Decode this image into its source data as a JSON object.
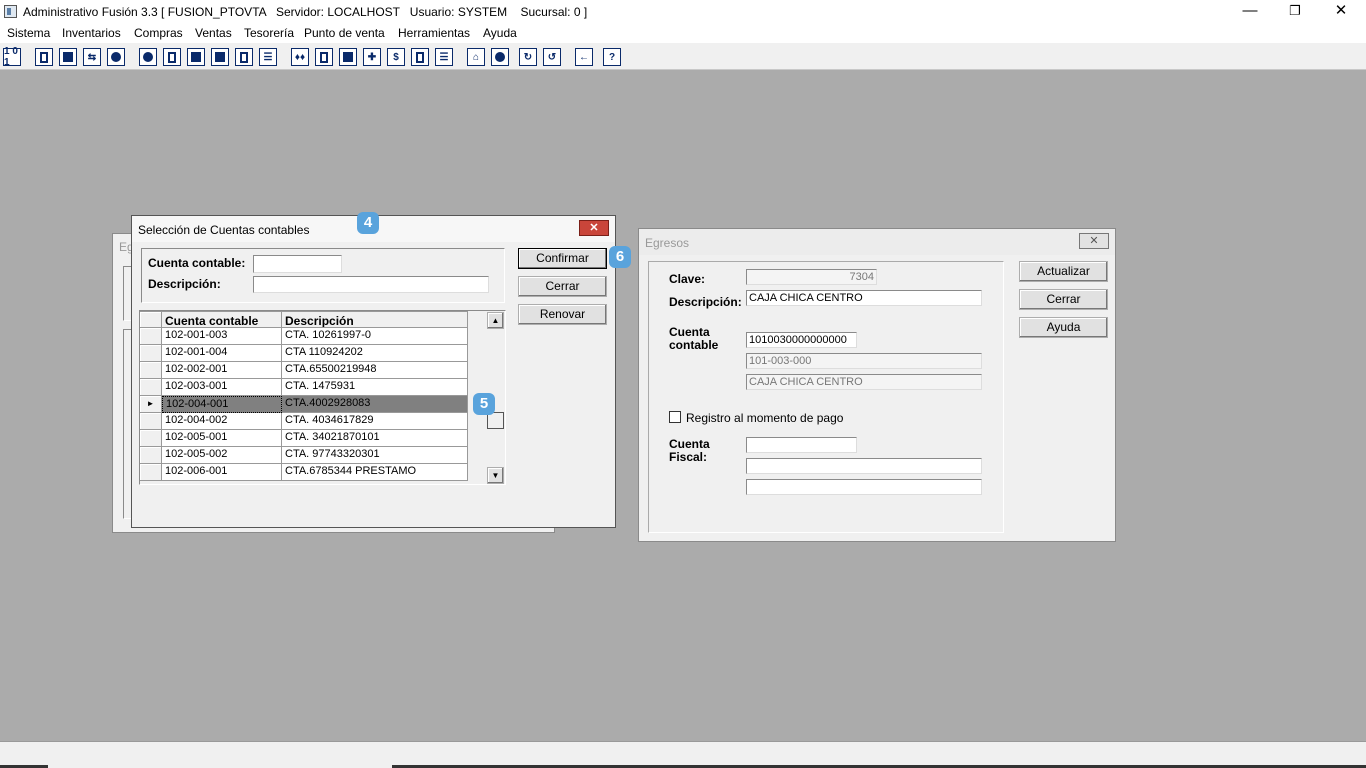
{
  "app": {
    "title": "Administrativo Fusión 3.3 [ FUSION_PTOVTA   Servidor: LOCALHOST   Usuario: SYSTEM    Sucursal: 0 ]",
    "controls": {
      "minimize": "—",
      "restore": "❐",
      "close": "✕"
    }
  },
  "menu": [
    "Sistema",
    "Inventarios",
    "Compras",
    "Ventas",
    "Tesorería",
    "Punto de venta",
    "Herramientas",
    "Ayuda"
  ],
  "toolbar_icons": [
    "calculator-icon",
    "window-icon",
    "clipboard-icon",
    "exchange-icon",
    "search-doc-icon",
    "user-icon",
    "folder-icon",
    "print-left-icon",
    "print-icon",
    "document-icon",
    "list-icon",
    "people-icon",
    "box-icon",
    "truck-icon",
    "add-icon",
    "dollar-icon",
    "report-icon",
    "table-icon",
    "home-icon",
    "zoom-icon",
    "refresh-icon",
    "undo-icon",
    "back-icon",
    "help-icon"
  ],
  "bg_window": {
    "title_fragment": "Eg"
  },
  "seleccion": {
    "title": "Selección de Cuentas contables",
    "close": "✕",
    "labels": {
      "cuenta": "Cuenta contable:",
      "descripcion": "Descripción:"
    },
    "inputs": {
      "cuenta": "",
      "descripcion": ""
    },
    "buttons": {
      "confirmar": "Confirmar",
      "cerrar": "Cerrar",
      "renovar": "Renovar"
    },
    "grid": {
      "headers": [
        "Cuenta contable",
        "Descripción"
      ],
      "selected_index": 4,
      "selected_marker": "►",
      "rows": [
        [
          "102-001-003",
          "CTA. 10261997-0"
        ],
        [
          "102-001-004",
          "CTA 110924202"
        ],
        [
          "102-002-001",
          "CTA.65500219948"
        ],
        [
          "102-003-001",
          "CTA. 1475931"
        ],
        [
          "102-004-001",
          "CTA.4002928083"
        ],
        [
          "102-004-002",
          "CTA. 4034617829"
        ],
        [
          "102-005-001",
          "CTA. 34021870101"
        ],
        [
          "102-005-002",
          "CTA. 97743320301"
        ],
        [
          "102-006-001",
          "CTA.6785344 PRESTAMO"
        ]
      ]
    },
    "scroll": {
      "up": "▲",
      "down": "▼"
    }
  },
  "badges": {
    "b4": "4",
    "b5": "5",
    "b6": "6"
  },
  "egresos": {
    "title": "Egresos",
    "close": "✕",
    "labels": {
      "clave": "Clave:",
      "descripcion": "Descripción:",
      "cuenta_contable_1": "Cuenta",
      "cuenta_contable_2": "contable",
      "registro": "Registro al momento de pago",
      "cuenta_fiscal_1": "Cuenta",
      "cuenta_fiscal_2": "Fiscal:"
    },
    "values": {
      "clave": "7304",
      "descripcion": "CAJA CHICA CENTRO",
      "cuenta_contable": "1010030000000000",
      "cuenta_codigo": "101-003-000",
      "cuenta_nombre": "CAJA CHICA CENTRO",
      "cuenta_fiscal": "",
      "fiscal_desc_1": "",
      "fiscal_desc_2": ""
    },
    "registro_checked": false,
    "buttons": {
      "actualizar": "Actualizar",
      "cerrar": "Cerrar",
      "ayuda": "Ayuda"
    }
  }
}
